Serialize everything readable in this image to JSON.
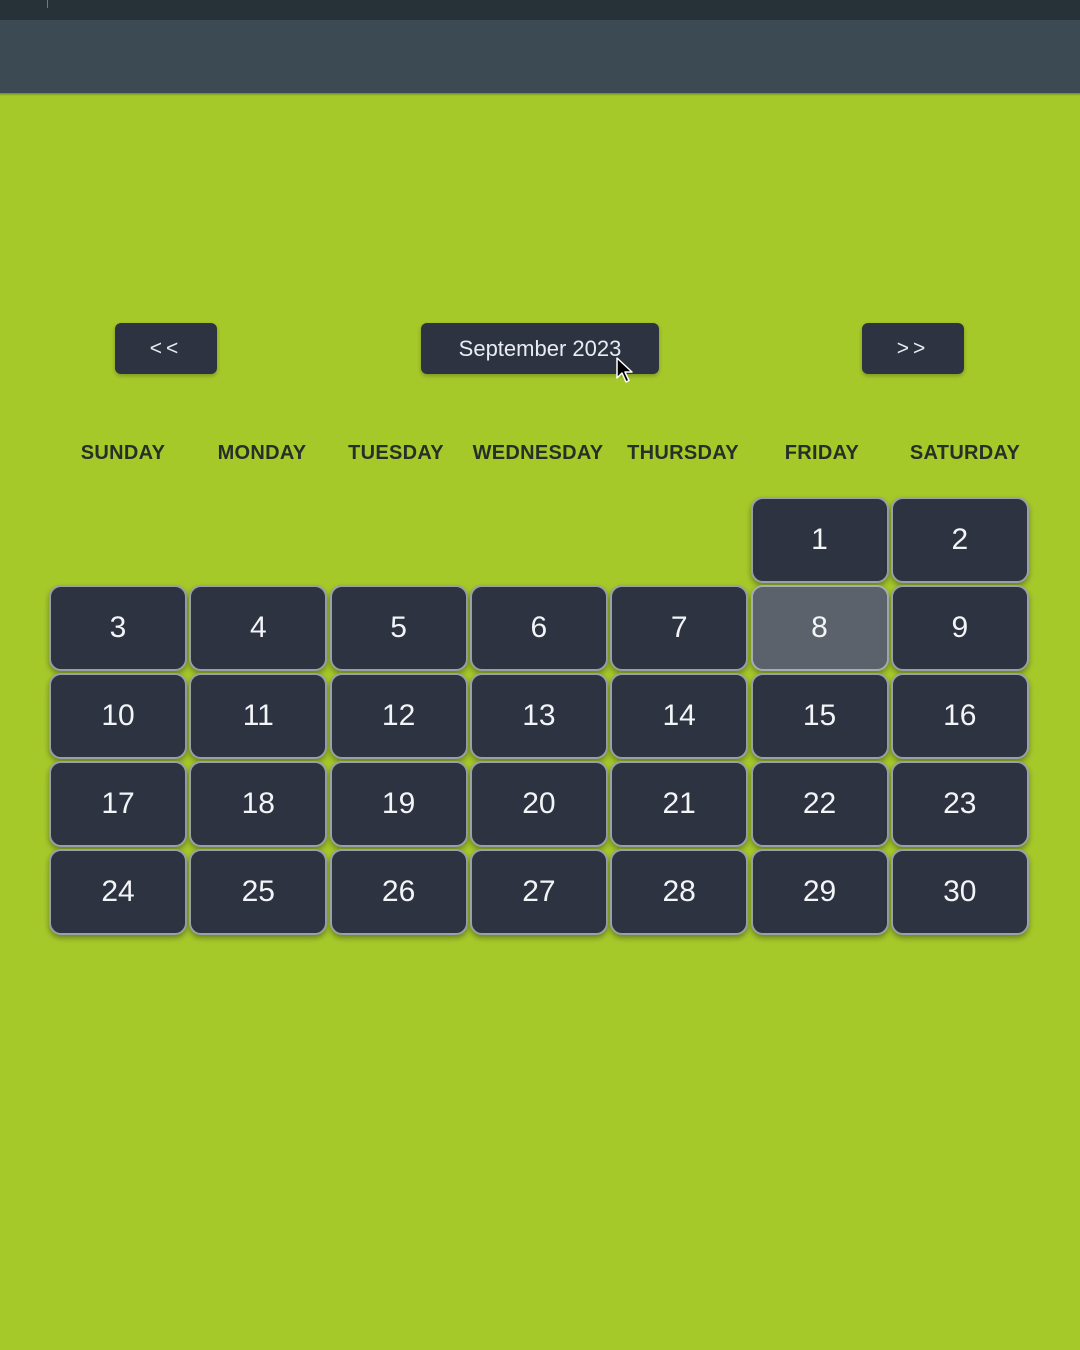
{
  "header": {},
  "nav": {
    "prev_label": "<<",
    "month_label": "September 2023",
    "next_label": ">>"
  },
  "weekdays": [
    "SUNDAY",
    "MONDAY",
    "TUESDAY",
    "WEDNESDAY",
    "THURSDAY",
    "FRIDAY",
    "SATURDAY"
  ],
  "calendar": {
    "first_weekday_index": 5,
    "days": [
      "1",
      "2",
      "3",
      "4",
      "5",
      "6",
      "7",
      "8",
      "9",
      "10",
      "11",
      "12",
      "13",
      "14",
      "15",
      "16",
      "17",
      "18",
      "19",
      "20",
      "21",
      "22",
      "23",
      "24",
      "25",
      "26",
      "27",
      "28",
      "29",
      "30"
    ],
    "highlighted_day": "8"
  },
  "colors": {
    "background": "#a6c92a",
    "topbar": "#3b4a53",
    "button": "#2e3341",
    "day_cell": "#2d3341",
    "highlighted_cell": "#5b626c"
  },
  "icons": {
    "cursor": "mouse-pointer-icon"
  }
}
